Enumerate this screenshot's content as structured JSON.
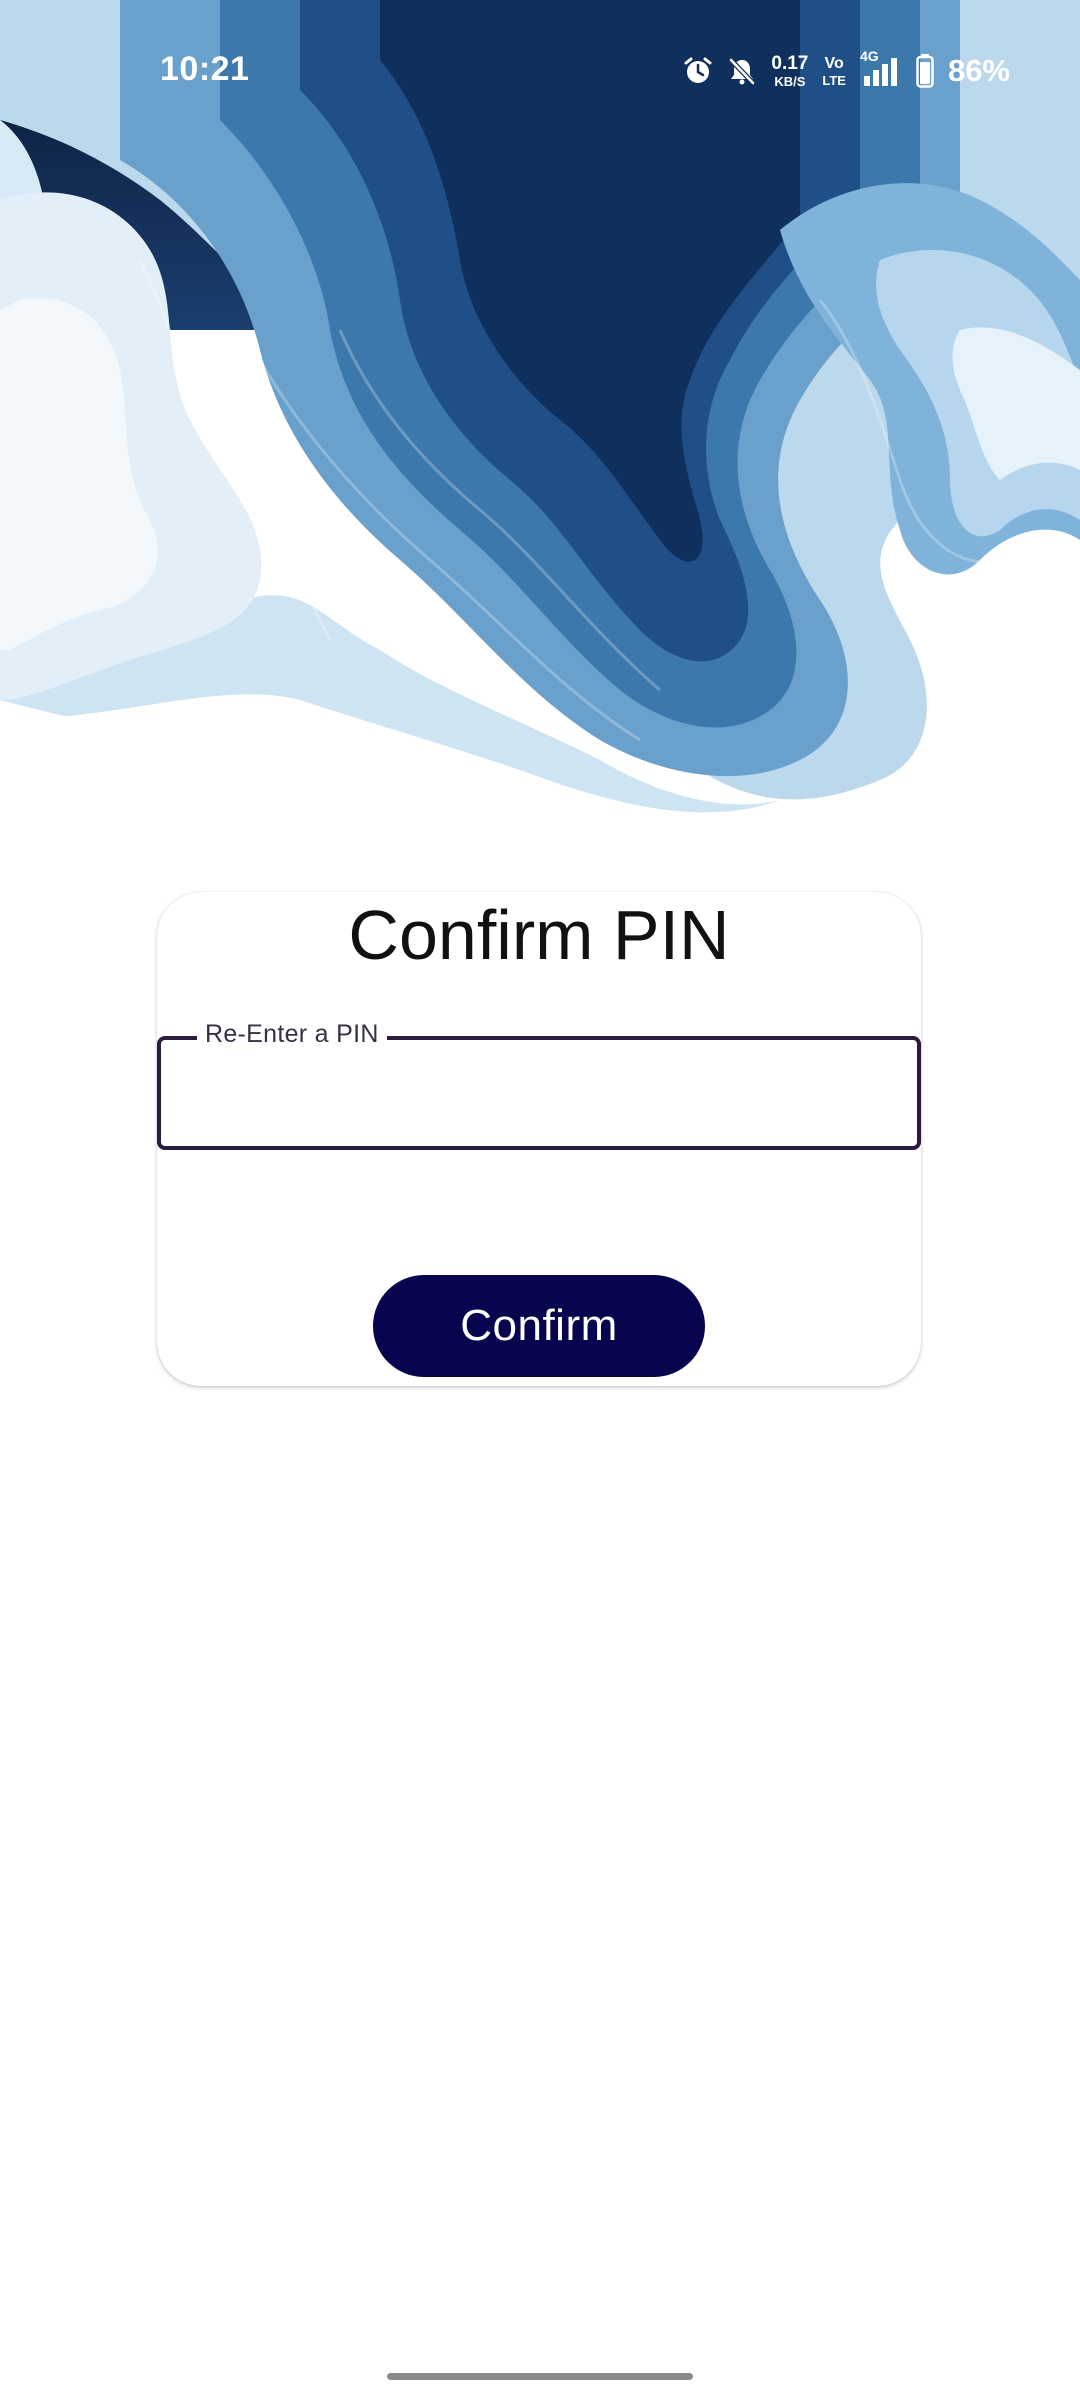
{
  "status_bar": {
    "time": "10:21",
    "net_speed_value": "0.17",
    "net_speed_unit": "KB/S",
    "volte_top": "Vo",
    "volte_bottom": "LTE",
    "network_type": "4G",
    "battery_percent": "86%",
    "icons": [
      "alarm-icon",
      "bell-muted-icon",
      "signal-icon",
      "battery-icon"
    ]
  },
  "card": {
    "title": "Confirm PIN",
    "pin_field_label": "Re-Enter a PIN",
    "pin_value": "",
    "confirm_label": "Confirm"
  },
  "colors": {
    "accent": "#080550",
    "field_border": "#2c1a3f",
    "wave_dark": "#0b1b3d",
    "wave_mid": "#3d78ad",
    "wave_light": "#c9e1f0"
  }
}
